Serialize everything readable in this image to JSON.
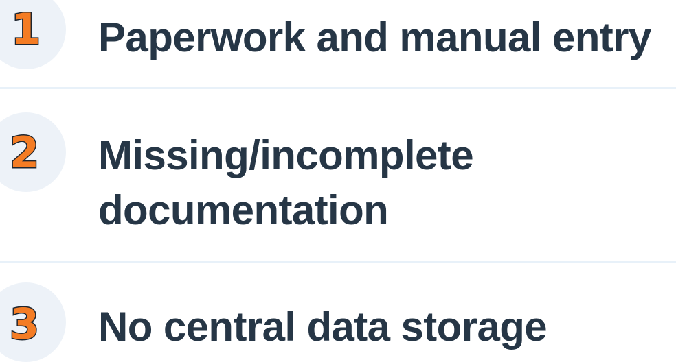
{
  "items": [
    {
      "number": "1",
      "label": "Paperwork and manual entry",
      "label_lines": [
        "Paperwork and manual entry"
      ]
    },
    {
      "number": "2",
      "label": "Missing/incomplete documentation",
      "label_lines": [
        "Missing/incomplete",
        "documentation"
      ]
    },
    {
      "number": "3",
      "label": "No central data storage",
      "label_lines": [
        "No central data storage"
      ]
    }
  ],
  "colors": {
    "number_fill": "#f47c24",
    "number_outline": "#1e2630",
    "badge_background": "#edf2f8",
    "label_text": "#263646",
    "divider": "#e8f1f9"
  }
}
